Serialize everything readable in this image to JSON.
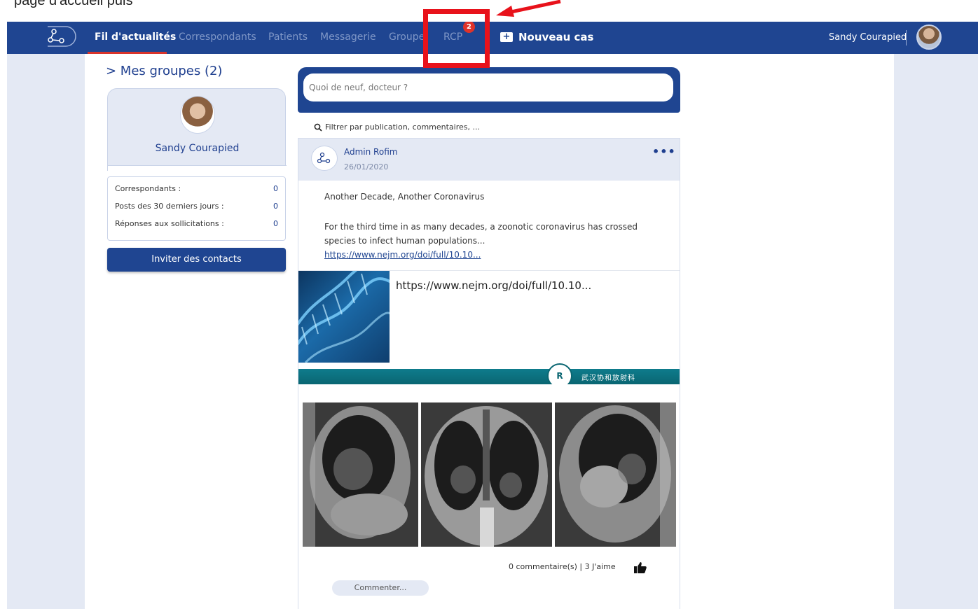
{
  "caption": {
    "text": "page d'accueil puis"
  },
  "nav": {
    "items": [
      {
        "label": "Fil d'actualités"
      },
      {
        "label": "Correspondants"
      },
      {
        "label": "Patients"
      },
      {
        "label": "Messagerie"
      },
      {
        "label": "Groupe"
      },
      {
        "label": "RCP"
      }
    ],
    "rcp_badge": "2",
    "new_case_label": "Nouveau cas",
    "user_name": "Sandy Courapied"
  },
  "sidebar": {
    "groups_title": "> Mes groupes (2)",
    "profile_name": "Sandy Courapied",
    "stats": [
      {
        "label": "Correspondants :",
        "value": "0"
      },
      {
        "label": "Posts des 30 derniers jours :",
        "value": "0"
      },
      {
        "label": "Réponses aux sollicitations :",
        "value": "0"
      }
    ],
    "invite_label": "Inviter des contacts"
  },
  "composer": {
    "placeholder": "Quoi de neuf, docteur ?"
  },
  "filter": {
    "label": "Filtrer par publication, commentaires, ..."
  },
  "post": {
    "author": "Admin Rofim",
    "date": "26/01/2020",
    "title": "Another Decade, Another Coronavirus",
    "body": "For the third time in as many decades, a zoonotic coronavirus has crossed species to infect human populations...",
    "link": "https://www.nejm.org/doi/full/10.10...",
    "preview_url": "https://www.nejm.org/doi/full/10.10...",
    "banner_text": "武汉协和放射科",
    "banner_logo": "R",
    "stats": "0 commentaire(s) | 3 J'aime",
    "comment_placeholder": "Commenter..."
  },
  "colors": {
    "nav_bg": "#1f4591",
    "accent_red": "#e8121b",
    "badge": "#e0332a",
    "page_bg": "#e4e9f4"
  }
}
